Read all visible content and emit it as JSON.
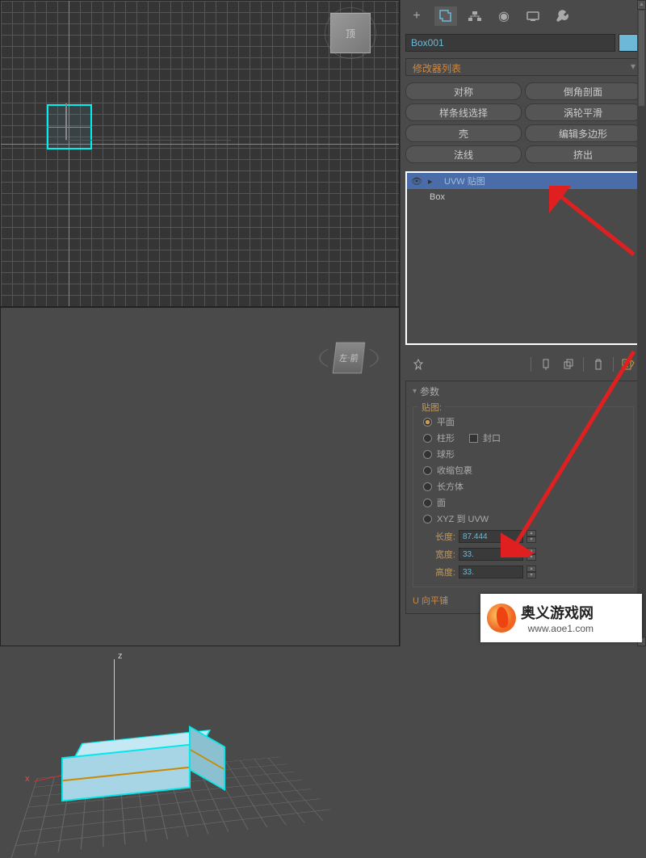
{
  "object_name": "Box001",
  "modifier_dropdown": "修改器列表",
  "preset_buttons": [
    "对称",
    "倒角剖面",
    "样条线选择",
    "涡轮平滑",
    "壳",
    "编辑多边形",
    "法线",
    "挤出"
  ],
  "stack": {
    "selected": "UVW 贴图",
    "child": "Box"
  },
  "rollout_title": "参数",
  "fieldset_title": "贴图:",
  "radios": {
    "plane": "平面",
    "cylinder": "柱形",
    "cap": "封口",
    "sphere": "球形",
    "shrink": "收缩包裹",
    "box": "长方体",
    "face": "面",
    "xyz": "XYZ 到 UVW"
  },
  "params": {
    "length_label": "长度:",
    "length_value": "87.444",
    "width_label": "宽度:",
    "width_value": "33.",
    "height_label": "高度:",
    "height_value": "33."
  },
  "tiling_label": "U 向平铺",
  "cube_front": "前",
  "cube_left": "左",
  "watermark": {
    "title": "奥义游戏网",
    "url": "www.aoe1.com"
  }
}
